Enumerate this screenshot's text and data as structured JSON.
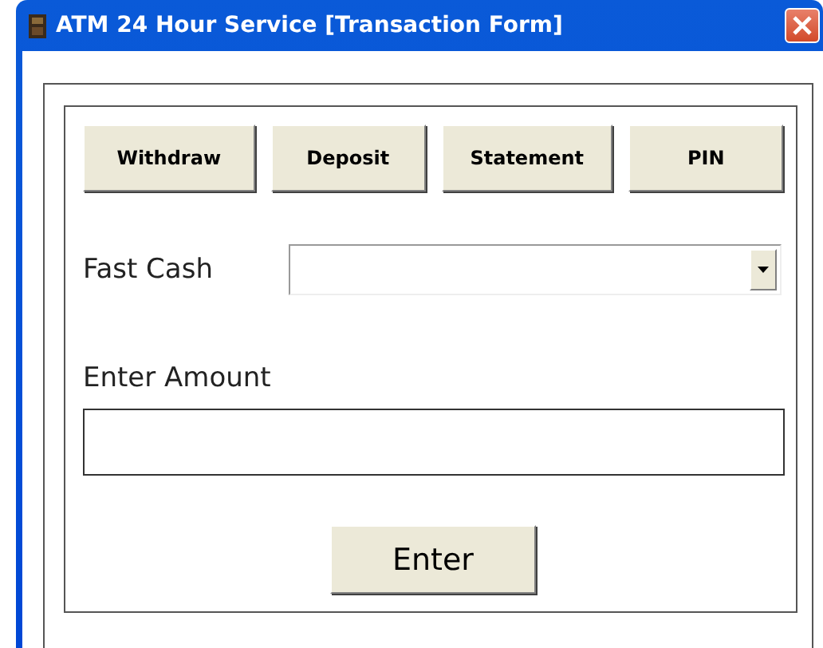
{
  "window": {
    "title": "ATM 24 Hour Service [Transaction Form]"
  },
  "buttons": [
    {
      "label": "Withdraw"
    },
    {
      "label": "Deposit"
    },
    {
      "label": "Statement"
    },
    {
      "label": "PIN"
    }
  ],
  "fast_cash": {
    "label": "Fast Cash"
  },
  "amount": {
    "label": "Enter Amount"
  },
  "submit": {
    "label": "Enter"
  }
}
